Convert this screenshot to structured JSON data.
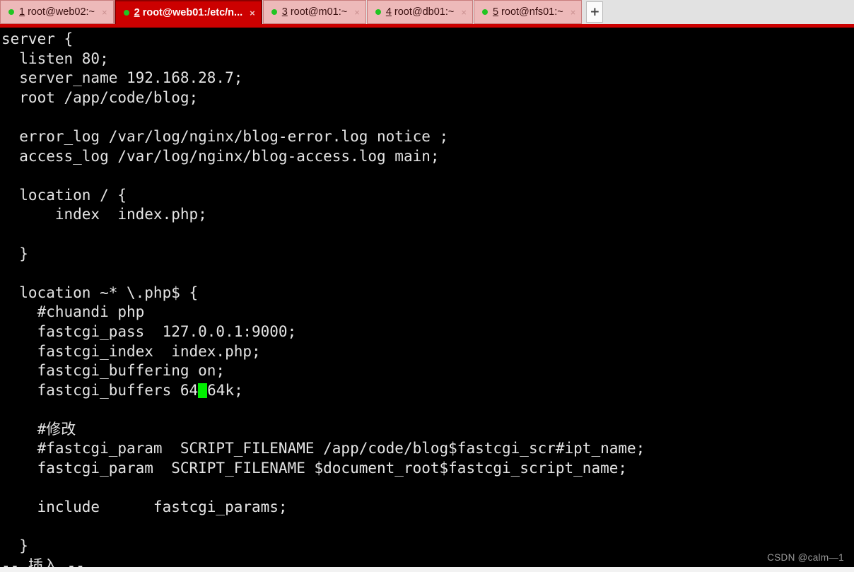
{
  "window": {
    "accent_red": "#cc0000",
    "tab_inactive_bg": "#edb9b9",
    "terminal_bg": "#000000",
    "terminal_fg": "#e4e4e4",
    "cursor_color": "#00ee00"
  },
  "tabbar": {
    "new_tab_label": "+",
    "close_glyph": "×",
    "tabs": [
      {
        "number": "1",
        "title": "root@web02:~",
        "active": false
      },
      {
        "number": "2",
        "title": "root@web01:/etc/n...",
        "active": true
      },
      {
        "number": "3",
        "title": "root@m01:~",
        "active": false
      },
      {
        "number": "4",
        "title": "root@db01:~",
        "active": false
      },
      {
        "number": "5",
        "title": "root@nfs01:~",
        "active": false
      }
    ]
  },
  "terminal": {
    "lines": [
      "server {",
      "  listen 80;",
      "  server_name 192.168.28.7;",
      "  root /app/code/blog;",
      "",
      "  error_log /var/log/nginx/blog-error.log notice ;",
      "  access_log /var/log/nginx/blog-access.log main;",
      "",
      "  location / {",
      "      index  index.php;",
      "",
      "  }",
      "",
      "  location ~* \\.php$ {",
      "    #chuandi php",
      "    fastcgi_pass  127.0.0.1:9000;",
      "    fastcgi_index  index.php;",
      "    fastcgi_buffering on;",
      "",
      "    #修改",
      "    #fastcgi_param  SCRIPT_FILENAME /app/code/blog$fastcgi_scr#ipt_name;",
      "    fastcgi_param  SCRIPT_FILENAME $document_root$fastcgi_script_name;",
      "",
      "    include      fastcgi_params;",
      "",
      "  }"
    ],
    "cursor_line": {
      "before": "    fastcgi_buffers 64",
      "after": "64k;"
    },
    "status_line": "-- 插入 --"
  },
  "watermark": {
    "text": "CSDN @calm—1"
  }
}
